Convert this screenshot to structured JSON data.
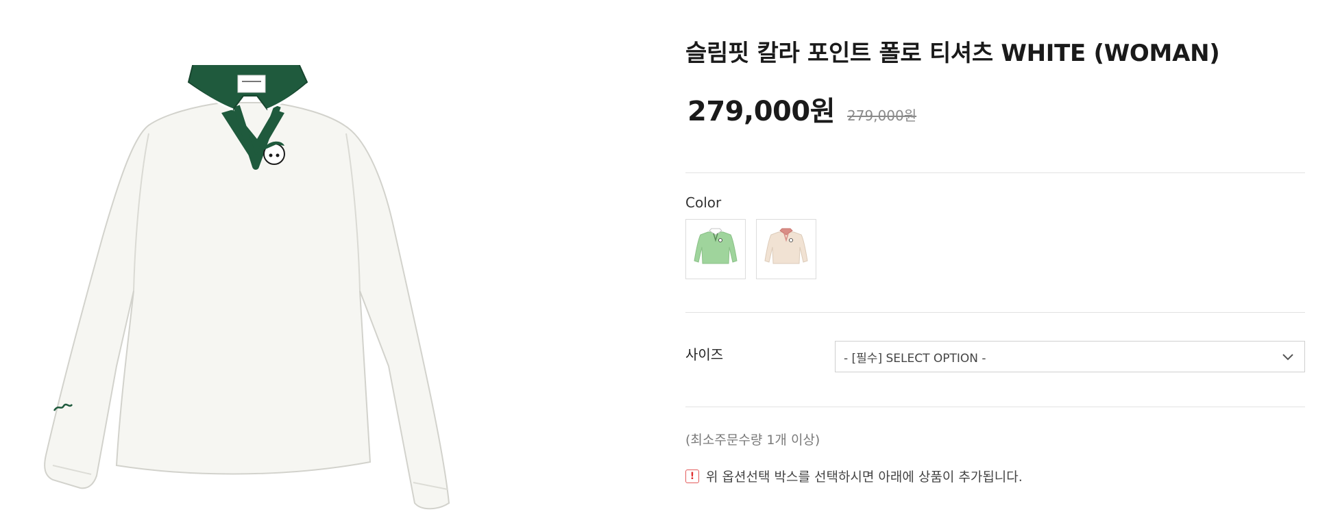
{
  "product": {
    "title": "슬림핏 칼라 포인트 폴로 티셔츠 WHITE (WOMAN)",
    "price": "279,000원",
    "original_price": "279,000원",
    "main_image": {
      "icon": "white-polo-shirt-photo",
      "collar_color": "#1f5a3d",
      "body_color": "#f6f6f2"
    }
  },
  "color_option": {
    "label": "Color",
    "swatches": [
      {
        "icon": "green-polo-thumbnail",
        "color": "#9fd49c",
        "collar_color": "#ffffff"
      },
      {
        "icon": "beige-polo-thumbnail",
        "color": "#f1e2d3",
        "collar_color": "#d98d86"
      }
    ]
  },
  "size_option": {
    "label": "사이즈",
    "selected": "- [필수] SELECT OPTION -",
    "icon": "chevron-down-icon"
  },
  "min_order_note": "(최소주문수량 1개 이상)",
  "notice": {
    "icon": "exclamation-icon",
    "icon_glyph": "!",
    "text": "위 옵션선택 박스를 선택하시면 아래에 상품이 추가됩니다."
  },
  "colors": {
    "notice_red": "#e02f2f",
    "divider": "#e2e2e2"
  }
}
